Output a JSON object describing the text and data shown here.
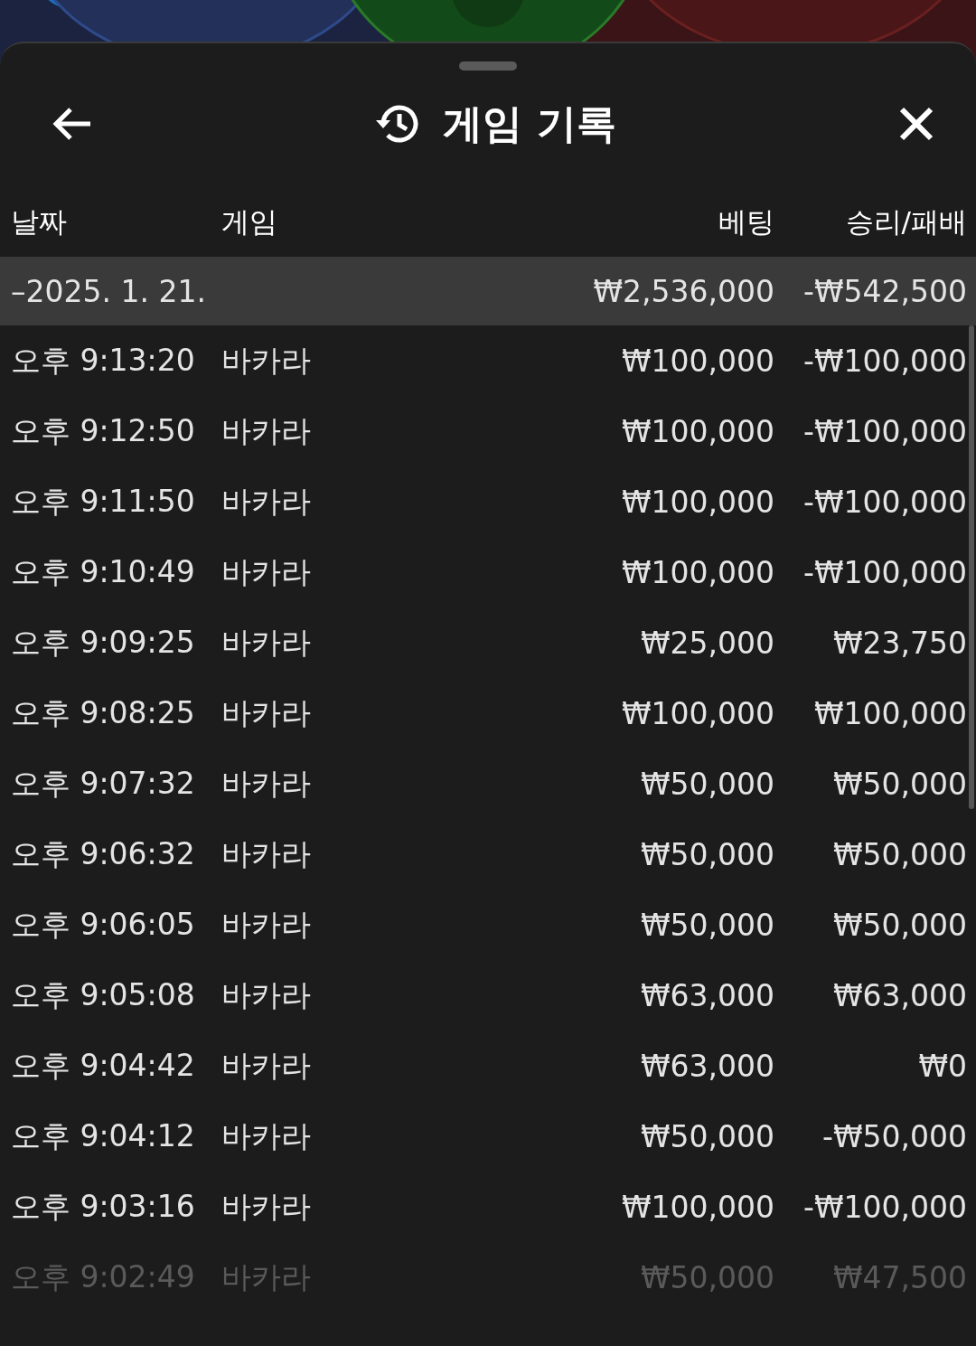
{
  "sheet": {
    "title": "게임 기록"
  },
  "columns": [
    "날짜",
    "게임",
    "베팅",
    "승리/패배"
  ],
  "group": {
    "date": "–2025. 1. 21.",
    "bet": "₩2,536,000",
    "result": "-₩542,500",
    "expanded": true
  },
  "rows": [
    {
      "time": "오후 9:13:20",
      "game": "바카라",
      "bet": "₩100,000",
      "result": "-₩100,000",
      "faded": false
    },
    {
      "time": "오후 9:12:50",
      "game": "바카라",
      "bet": "₩100,000",
      "result": "-₩100,000",
      "faded": false
    },
    {
      "time": "오후 9:11:50",
      "game": "바카라",
      "bet": "₩100,000",
      "result": "-₩100,000",
      "faded": false
    },
    {
      "time": "오후 9:10:49",
      "game": "바카라",
      "bet": "₩100,000",
      "result": "-₩100,000",
      "faded": false
    },
    {
      "time": "오후 9:09:25",
      "game": "바카라",
      "bet": "₩25,000",
      "result": "₩23,750",
      "faded": false
    },
    {
      "time": "오후 9:08:25",
      "game": "바카라",
      "bet": "₩100,000",
      "result": "₩100,000",
      "faded": false
    },
    {
      "time": "오후 9:07:32",
      "game": "바카라",
      "bet": "₩50,000",
      "result": "₩50,000",
      "faded": false
    },
    {
      "time": "오후 9:06:32",
      "game": "바카라",
      "bet": "₩50,000",
      "result": "₩50,000",
      "faded": false
    },
    {
      "time": "오후 9:06:05",
      "game": "바카라",
      "bet": "₩50,000",
      "result": "₩50,000",
      "faded": false
    },
    {
      "time": "오후 9:05:08",
      "game": "바카라",
      "bet": "₩63,000",
      "result": "₩63,000",
      "faded": false
    },
    {
      "time": "오후 9:04:42",
      "game": "바카라",
      "bet": "₩63,000",
      "result": "₩0",
      "faded": false
    },
    {
      "time": "오후 9:04:12",
      "game": "바카라",
      "bet": "₩50,000",
      "result": "-₩50,000",
      "faded": false
    },
    {
      "time": "오후 9:03:16",
      "game": "바카라",
      "bet": "₩100,000",
      "result": "-₩100,000",
      "faded": false
    },
    {
      "time": "오후 9:02:49",
      "game": "바카라",
      "bet": "₩50,000",
      "result": "₩47,500",
      "faded": true
    }
  ]
}
